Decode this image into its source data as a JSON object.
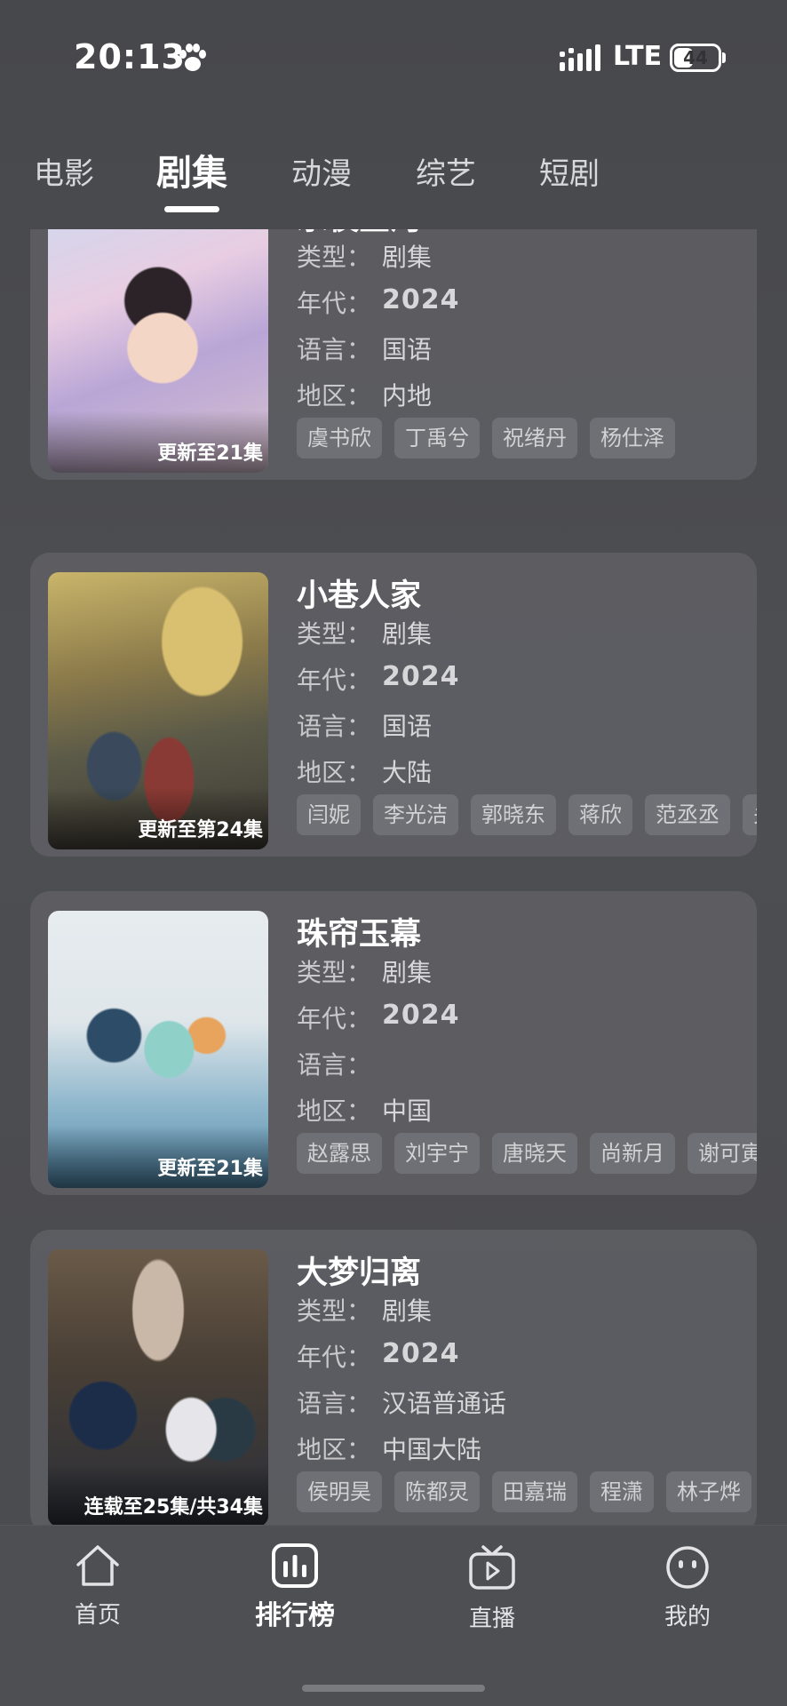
{
  "status_bar": {
    "time": "20:13",
    "network": "LTE",
    "battery": "44",
    "battery_level": 0.44
  },
  "tabs": [
    {
      "label": "电影",
      "active": false
    },
    {
      "label": "剧集",
      "active": true
    },
    {
      "label": "动漫",
      "active": false
    },
    {
      "label": "综艺",
      "active": false
    },
    {
      "label": "短剧",
      "active": false
    }
  ],
  "field_labels": {
    "type": "类型：",
    "year": "年代：",
    "language": "语言：",
    "region": "地区："
  },
  "shows": [
    {
      "title": "永夜星河",
      "update": "更新至21集",
      "type": "剧集",
      "year": "2024",
      "language": "国语",
      "region": "内地",
      "cast": [
        "虞书欣",
        "丁禹兮",
        "祝绪丹",
        "杨仕泽"
      ]
    },
    {
      "title": "小巷人家",
      "update": "更新至第24集",
      "type": "剧集",
      "year": "2024",
      "language": "国语",
      "region": "大陆",
      "cast": [
        "闫妮",
        "李光洁",
        "郭晓东",
        "蒋欣",
        "范丞丞",
        "关"
      ]
    },
    {
      "title": "珠帘玉幕",
      "update": "更新至21集",
      "type": "剧集",
      "year": "2024",
      "language": "",
      "region": "中国",
      "cast": [
        "赵露思",
        "刘宇宁",
        "唐晓天",
        "尚新月",
        "谢可寅"
      ]
    },
    {
      "title": "大梦归离",
      "update": "连载至25集/共34集",
      "type": "剧集",
      "year": "2024",
      "language": "汉语普通话",
      "region": "中国大陆",
      "cast": [
        "侯明昊",
        "陈都灵",
        "田嘉瑞",
        "程潇",
        "林子烨"
      ]
    }
  ],
  "bottom_nav": [
    {
      "label": "首页",
      "icon": "home-icon",
      "active": false
    },
    {
      "label": "排行榜",
      "icon": "ranking-icon",
      "active": true
    },
    {
      "label": "直播",
      "icon": "live-tv-icon",
      "active": false
    },
    {
      "label": "我的",
      "icon": "profile-face-icon",
      "active": false
    }
  ]
}
